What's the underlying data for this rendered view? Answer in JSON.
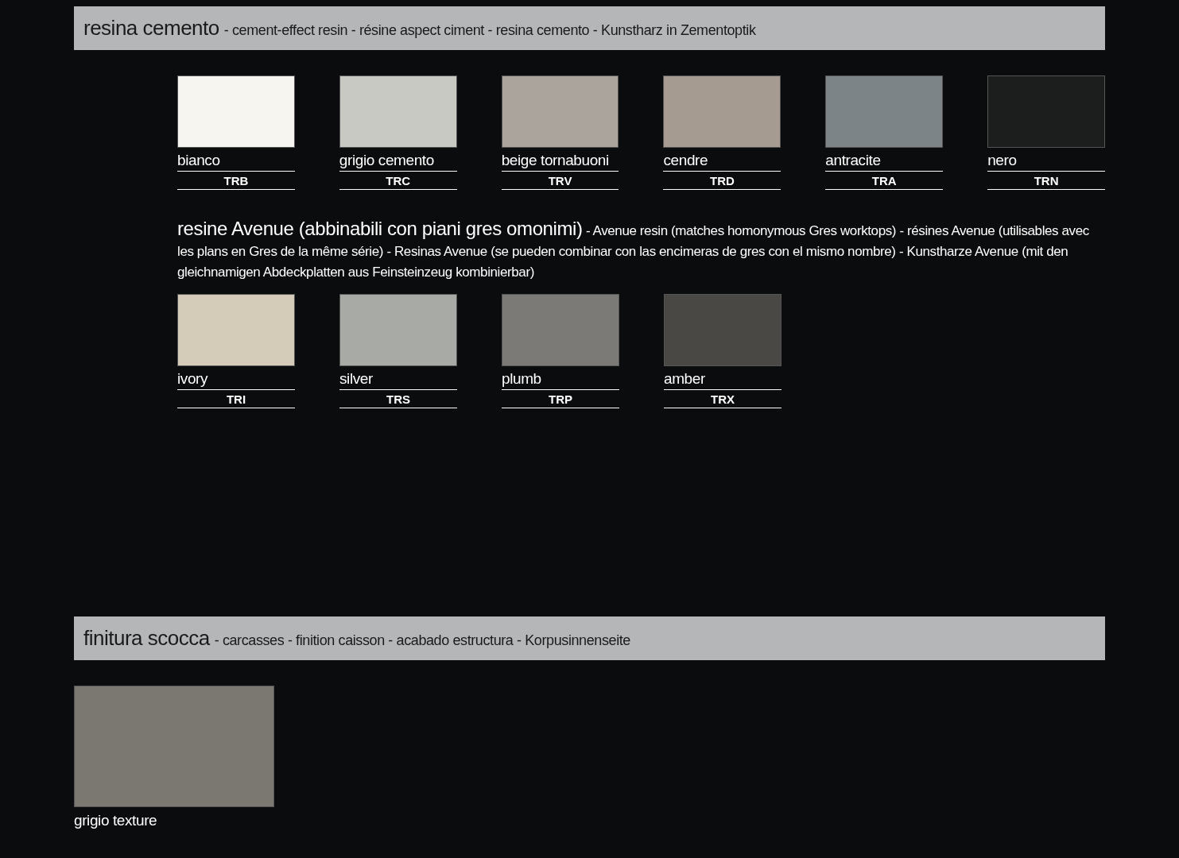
{
  "section_1": {
    "title": "resina cemento",
    "subtitle": "- cement-effect resin - résine aspect ciment - resina cemento - Kunstharz in Zementoptik",
    "swatches": [
      {
        "name": "bianco",
        "code": "TRB",
        "color": "#f6f5f0"
      },
      {
        "name": "grigio cemento",
        "code": "TRC",
        "color": "#c9c9c4"
      },
      {
        "name": "beige tornabuoni",
        "code": "TRV",
        "color": "#aaa49c"
      },
      {
        "name": "cendre",
        "code": "TRD",
        "color": "#a59b90"
      },
      {
        "name": "antracite",
        "code": "TRA",
        "color": "#7c8487"
      },
      {
        "name": "nero",
        "code": "TRN",
        "color": "#1c1d1d"
      }
    ],
    "subheading": {
      "lead": "resine Avenue (abbinabili con piani gres omonimi)",
      "text": "- Avenue resin (matches homonymous Gres worktops) - résines Avenue (utilisables avec les plans en Gres de la même série) - Resinas Avenue (se pueden combinar con las encimeras de gres con el mismo nombre) - Kunstharze Avenue (mit den gleichnamigen Abdeckplatten aus Feinsteinzeug  kombinierbar)"
    },
    "swatches_2": [
      {
        "name": "ivory",
        "code": "TRI",
        "color": "#d4cbb9"
      },
      {
        "name": "silver",
        "code": "TRS",
        "color": "#a8aaa6"
      },
      {
        "name": "plumb",
        "code": "TRP",
        "color": "#7b7a76"
      },
      {
        "name": "amber",
        "code": "TRX",
        "color": "#4a4844"
      }
    ]
  },
  "section_2": {
    "title": "finitura scocca",
    "subtitle": "- carcasses - finition caisson - acabado estructura - Korpusinnenseite",
    "swatches": [
      {
        "name": "grigio texture",
        "color": "#7a7870"
      }
    ]
  }
}
